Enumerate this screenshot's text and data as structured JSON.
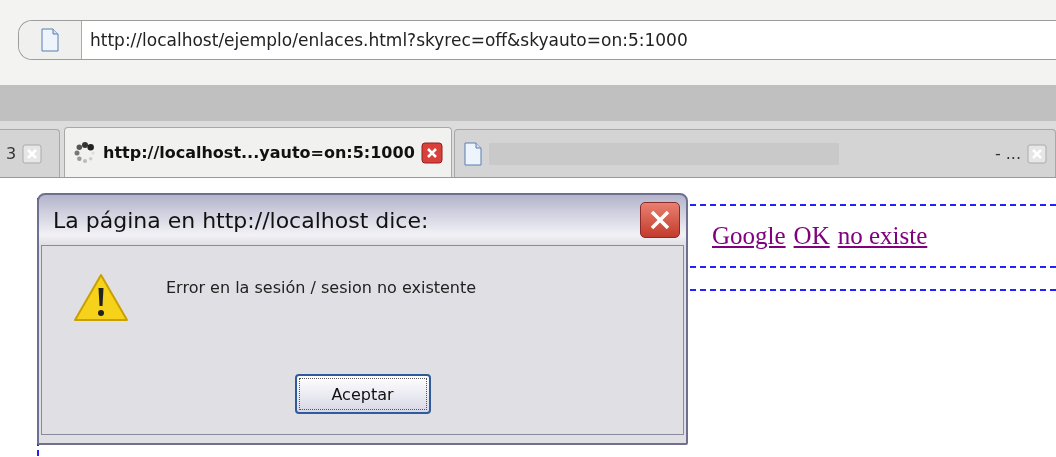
{
  "address_bar": {
    "url": "http://localhost/ejemplo/enlaces.html?skyrec=off&skyauto=on:5:1000"
  },
  "tabs": [
    {
      "kind": "partial",
      "label": "3",
      "selected": false
    },
    {
      "kind": "loading",
      "label": "http://localhost...yauto=on:5:1000",
      "selected": true
    },
    {
      "kind": "redacted",
      "label": "- ...",
      "selected": false
    }
  ],
  "page": {
    "links": [
      "Google",
      "OK",
      "no existe"
    ]
  },
  "dialog": {
    "title": "La página en http://localhost dice:",
    "message": "Error en la sesión / sesion no existente",
    "button": "Aceptar"
  }
}
